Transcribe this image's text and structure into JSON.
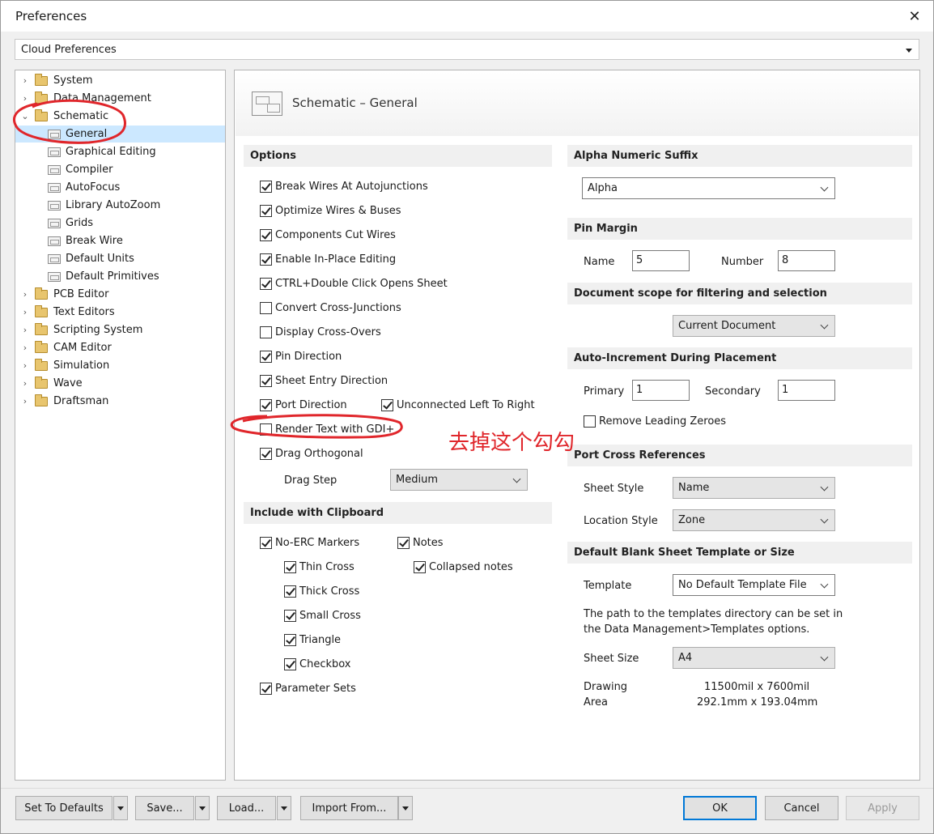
{
  "window": {
    "title": "Preferences",
    "close_glyph": "✕"
  },
  "top_combo": {
    "value": "Cloud Preferences"
  },
  "tree": [
    {
      "label": "System",
      "type": "folder",
      "expanded": false
    },
    {
      "label": "Data Management",
      "type": "folder",
      "expanded": false
    },
    {
      "label": "Schematic",
      "type": "folder",
      "expanded": true
    },
    {
      "label": "General",
      "type": "page",
      "selected": true
    },
    {
      "label": "Graphical Editing",
      "type": "page"
    },
    {
      "label": "Compiler",
      "type": "page"
    },
    {
      "label": "AutoFocus",
      "type": "page"
    },
    {
      "label": "Library AutoZoom",
      "type": "page"
    },
    {
      "label": "Grids",
      "type": "page"
    },
    {
      "label": "Break Wire",
      "type": "page"
    },
    {
      "label": "Default Units",
      "type": "page"
    },
    {
      "label": "Default Primitives",
      "type": "page"
    },
    {
      "label": "PCB Editor",
      "type": "folder",
      "expanded": false
    },
    {
      "label": "Text Editors",
      "type": "folder",
      "expanded": false
    },
    {
      "label": "Scripting System",
      "type": "folder",
      "expanded": false
    },
    {
      "label": "CAM Editor",
      "type": "folder",
      "expanded": false
    },
    {
      "label": "Simulation",
      "type": "folder",
      "expanded": false
    },
    {
      "label": "Wave",
      "type": "folder",
      "expanded": false
    },
    {
      "label": "Draftsman",
      "type": "folder",
      "expanded": false
    }
  ],
  "panel": {
    "title": "Schematic – General"
  },
  "options": {
    "header": "Options",
    "items": [
      {
        "label": "Break Wires At Autojunctions",
        "checked": true
      },
      {
        "label": "Optimize Wires & Buses",
        "checked": true
      },
      {
        "label": "Components Cut Wires",
        "checked": true
      },
      {
        "label": "Enable In-Place Editing",
        "checked": true
      },
      {
        "label": "CTRL+Double Click Opens Sheet",
        "checked": true
      },
      {
        "label": "Convert Cross-Junctions",
        "checked": false
      },
      {
        "label": "Display Cross-Overs",
        "checked": false
      },
      {
        "label": "Pin Direction",
        "checked": true
      },
      {
        "label": "Sheet Entry Direction",
        "checked": true
      },
      {
        "label": "Port Direction",
        "checked": true
      },
      {
        "label": "Unconnected Left To Right",
        "checked": true
      },
      {
        "label": "Render Text with GDI+",
        "checked": false
      },
      {
        "label": "Drag Orthogonal",
        "checked": true
      }
    ],
    "drag_step_label": "Drag Step",
    "drag_step_value": "Medium"
  },
  "clipboard": {
    "header": "Include with Clipboard",
    "items": [
      {
        "label": "No-ERC Markers",
        "checked": true
      },
      {
        "label": "Thin Cross",
        "checked": true
      },
      {
        "label": "Thick Cross",
        "checked": true
      },
      {
        "label": "Small Cross",
        "checked": true
      },
      {
        "label": "Triangle",
        "checked": true
      },
      {
        "label": "Checkbox",
        "checked": true
      },
      {
        "label": "Parameter Sets",
        "checked": true
      },
      {
        "label": "Notes",
        "checked": true
      },
      {
        "label": "Collapsed notes",
        "checked": true
      }
    ]
  },
  "alpha": {
    "header": "Alpha Numeric Suffix",
    "value": "Alpha"
  },
  "pin_margin": {
    "header": "Pin Margin",
    "name_label": "Name",
    "name_value": "5",
    "number_label": "Number",
    "number_value": "8"
  },
  "doc_scope": {
    "header": "Document scope for filtering and selection",
    "value": "Current Document"
  },
  "auto_inc": {
    "header": "Auto-Increment During Placement",
    "primary_label": "Primary",
    "primary_value": "1",
    "secondary_label": "Secondary",
    "secondary_value": "1",
    "remove_zeroes_label": "Remove Leading Zeroes",
    "remove_zeroes_checked": false
  },
  "port_xref": {
    "header": "Port Cross References",
    "sheet_style_label": "Sheet Style",
    "sheet_style_value": "Name",
    "location_style_label": "Location Style",
    "location_style_value": "Zone"
  },
  "template": {
    "header": "Default Blank Sheet Template or Size",
    "template_label": "Template",
    "template_value": "No Default Template File",
    "note_line1": "The path to the templates directory can be set in",
    "note_line2": "the Data Management>Templates options.",
    "sheet_size_label": "Sheet Size",
    "sheet_size_value": "A4",
    "drawing_label1": "Drawing",
    "drawing_label2": "Area",
    "drawing_value1": "11500mil x 7600mil",
    "drawing_value2": "292.1mm x 193.04mm"
  },
  "buttons": {
    "set_defaults": "Set To Defaults",
    "save": "Save...",
    "load": "Load...",
    "import_from": "Import From...",
    "ok": "OK",
    "cancel": "Cancel",
    "apply": "Apply"
  },
  "annotation": {
    "text": "去掉这个勾勾",
    "color": "#e0262b"
  }
}
